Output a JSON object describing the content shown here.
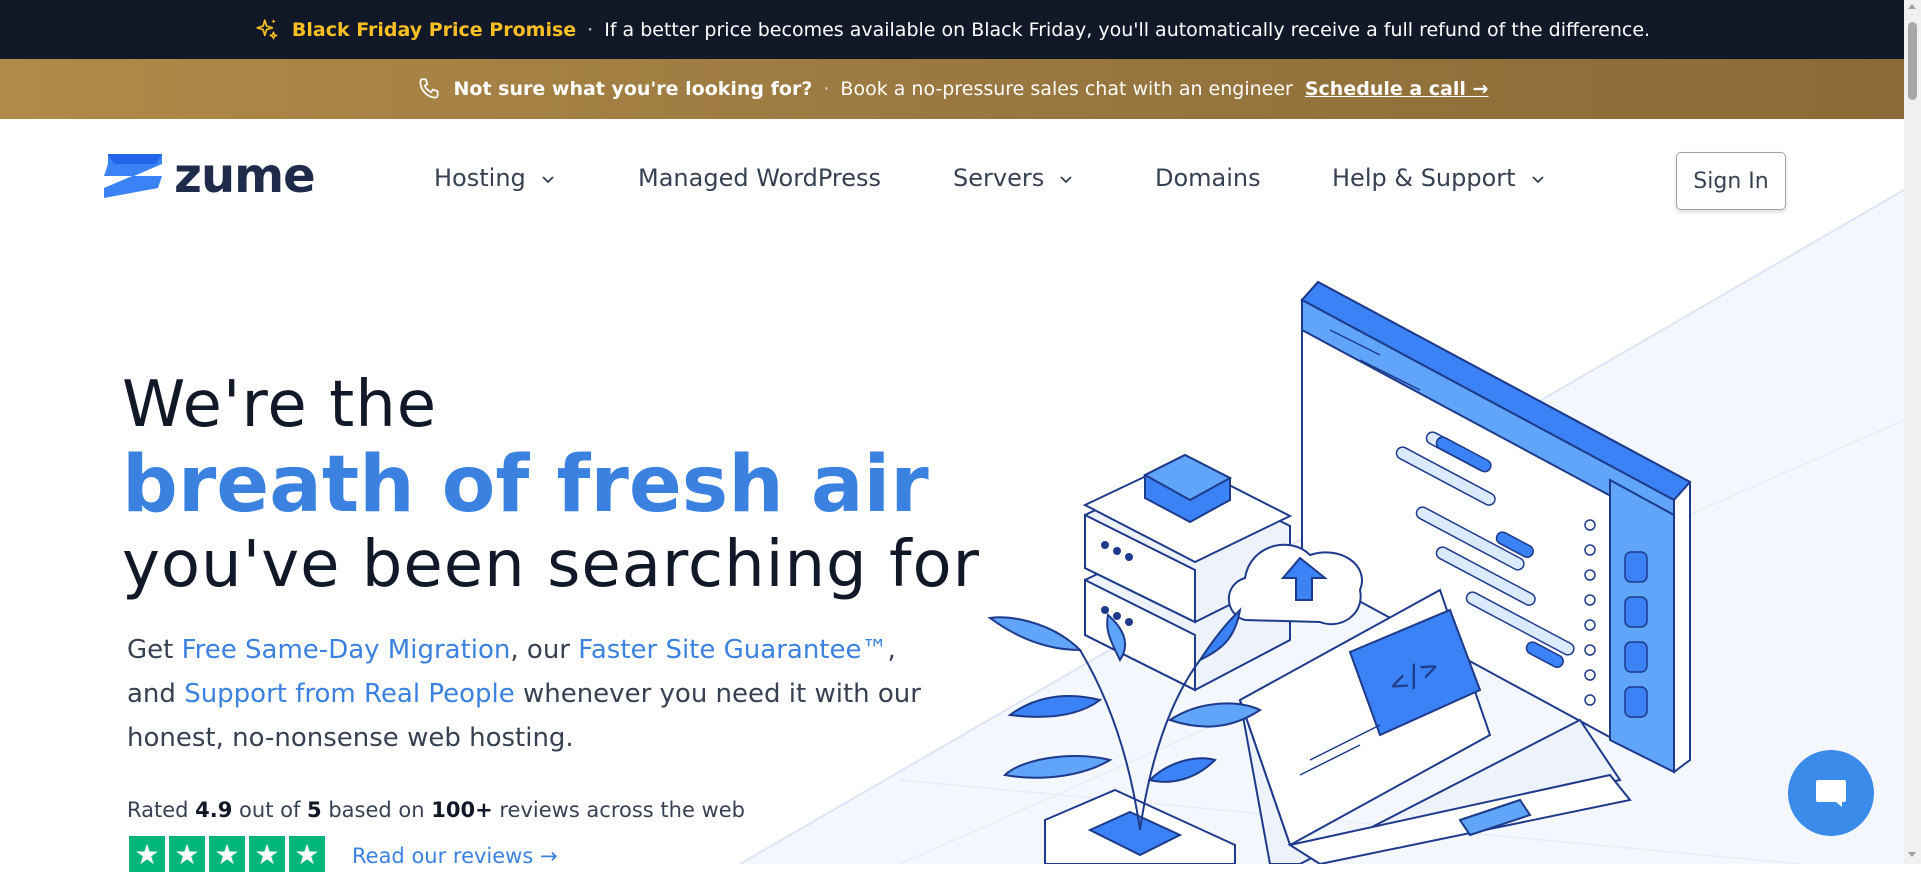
{
  "promo": {
    "title": "Black Friday Price Promise",
    "separator": "·",
    "message": "If a better price becomes available on Black Friday, you'll automatically receive a full refund of the difference.",
    "icon": "sparkle-icon"
  },
  "sales": {
    "question": "Not sure what you're looking for?",
    "separator": "·",
    "message": "Book a no-pressure sales chat with an engineer",
    "link": "Schedule a call →",
    "icon": "phone-icon"
  },
  "nav": {
    "logo_text": "zume",
    "items": [
      {
        "label": "Hosting",
        "dropdown": true
      },
      {
        "label": "Managed WordPress",
        "dropdown": false
      },
      {
        "label": "Servers",
        "dropdown": true
      },
      {
        "label": "Domains",
        "dropdown": false
      },
      {
        "label": "Help & Support",
        "dropdown": true
      }
    ],
    "signin": "Sign In"
  },
  "hero": {
    "line1": "We're the",
    "line2": "breath of fresh air",
    "line3": "you've been searching for",
    "desc_get": "Get ",
    "link_migration": "Free Same-Day Migration",
    "desc_our": ", our ",
    "link_faster": "Faster Site Guarantee™",
    "desc_and": ", and ",
    "link_support": "Support from Real People",
    "desc_rest": " whenever you need it with our honest, no-nonsense web hosting."
  },
  "rating": {
    "prefix": "Rated ",
    "score": "4.9",
    "mid": " out of ",
    "max": "5",
    "based": " based on ",
    "count": "100+",
    "suffix": " reviews across the web",
    "stars": 5,
    "read_link": "Read our reviews →"
  },
  "colors": {
    "accent": "#3b82e0",
    "dark": "#111827",
    "gold": "#fbbf24",
    "trustpilot": "#00b67a"
  }
}
